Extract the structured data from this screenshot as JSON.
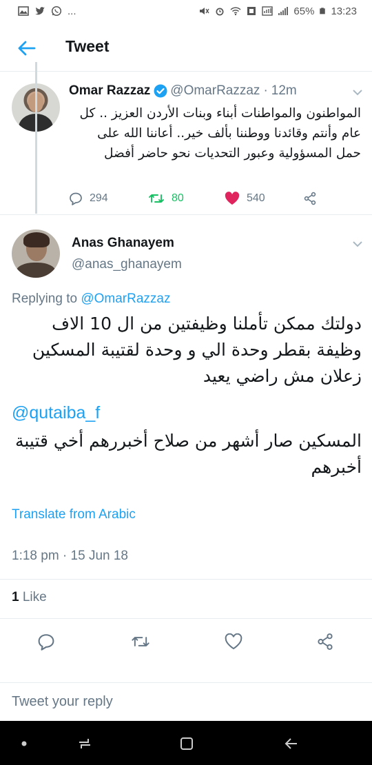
{
  "status_bar": {
    "overflow": "...",
    "battery": "65%",
    "time": "13:23"
  },
  "header": {
    "title": "Tweet"
  },
  "original_tweet": {
    "name": "Omar Razzaz",
    "handle": "@OmarRazzaz",
    "separator": "·",
    "time": "12m",
    "text": "المواطنون والمواطنات أبناء وبنات الأردن العزيز .. كل عام وأنتم وقائدنا ووطننا بألف خير.. أعاننا الله على حمل المسؤولية وعبور التحديات نحو حاضر أفضل",
    "replies": "294",
    "retweets": "80",
    "likes": "540"
  },
  "reply_tweet": {
    "name": "Anas Ghanayem",
    "handle": "@anas_ghanayem",
    "replying_prefix": "Replying to",
    "replying_to": "@OmarRazzaz",
    "text_part1": "دولتك ممكن تأملنا وظيفتين من ال 10 الاف وظيفة بقطر وحدة الي و وحدة لقتيبة المسكين زعلان مش راضي يعيد",
    "mention": "@qutaiba_f",
    "text_part2": "المسكين صار أشهر من صلاح أخبررهم أخي قتيبة أخبرهم",
    "translate": "Translate from Arabic",
    "timestamp": "1:18 pm · 15 Jun 18",
    "like_count": "1",
    "like_label": "Like"
  },
  "reply_box": {
    "placeholder": "Tweet your reply"
  },
  "colors": {
    "accent": "#1da1f2",
    "retweet_green": "#17bf63",
    "like_red": "#e0245e",
    "muted": "#657786"
  }
}
